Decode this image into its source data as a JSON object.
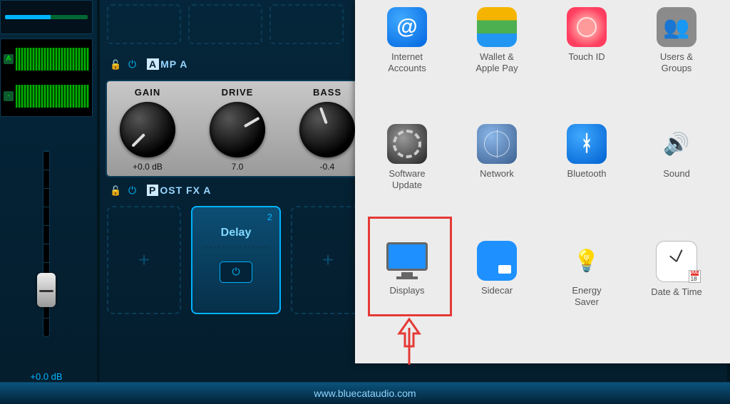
{
  "left": {
    "fader_readout": "+0.0 dB"
  },
  "amp_section": {
    "title_first": "A",
    "title_rest": "MP A",
    "knobs": [
      {
        "label": "GAIN",
        "value": "+0.0 dB"
      },
      {
        "label": "DRIVE",
        "value": "7.0"
      },
      {
        "label": "BASS",
        "value": "-0.4"
      }
    ]
  },
  "postfx_section": {
    "title_first": "P",
    "title_rest": "OST FX A",
    "pedal": {
      "index": "2",
      "name": "Delay"
    }
  },
  "footer_url": "www.bluecataudio.com",
  "prefs": {
    "items": [
      {
        "id": "internet-accounts",
        "label": "Internet\nAccounts",
        "icon": "ic-internet",
        "glyph_class": "icon-at"
      },
      {
        "id": "wallet",
        "label": "Wallet &\nApple Pay",
        "icon": "ic-wallet"
      },
      {
        "id": "touch-id",
        "label": "Touch ID",
        "icon": "ic-touch"
      },
      {
        "id": "users-groups",
        "label": "Users &\nGroups",
        "icon": "ic-users",
        "glyph_class": "icon-users"
      },
      {
        "id": "software-update",
        "label": "Software\nUpdate",
        "icon": "ic-sw"
      },
      {
        "id": "network",
        "label": "Network",
        "icon": "ic-net"
      },
      {
        "id": "bluetooth",
        "label": "Bluetooth",
        "icon": "ic-bt",
        "glyph_class": "icon-bt"
      },
      {
        "id": "sound",
        "label": "Sound",
        "icon": "ic-sound",
        "glyph_class": "icon-speaker"
      },
      {
        "id": "displays",
        "label": "Displays",
        "icon": "ic-disp",
        "special": "display"
      },
      {
        "id": "sidecar",
        "label": "Sidecar",
        "icon": "ic-side"
      },
      {
        "id": "energy-saver",
        "label": "Energy\nSaver",
        "icon": "ic-energy",
        "glyph_class": "icon-bulb"
      },
      {
        "id": "date-time",
        "label": "Date & Time",
        "icon": "ic-date",
        "special": "clock",
        "cal_month": "JUL",
        "cal_day": "18"
      }
    ]
  }
}
